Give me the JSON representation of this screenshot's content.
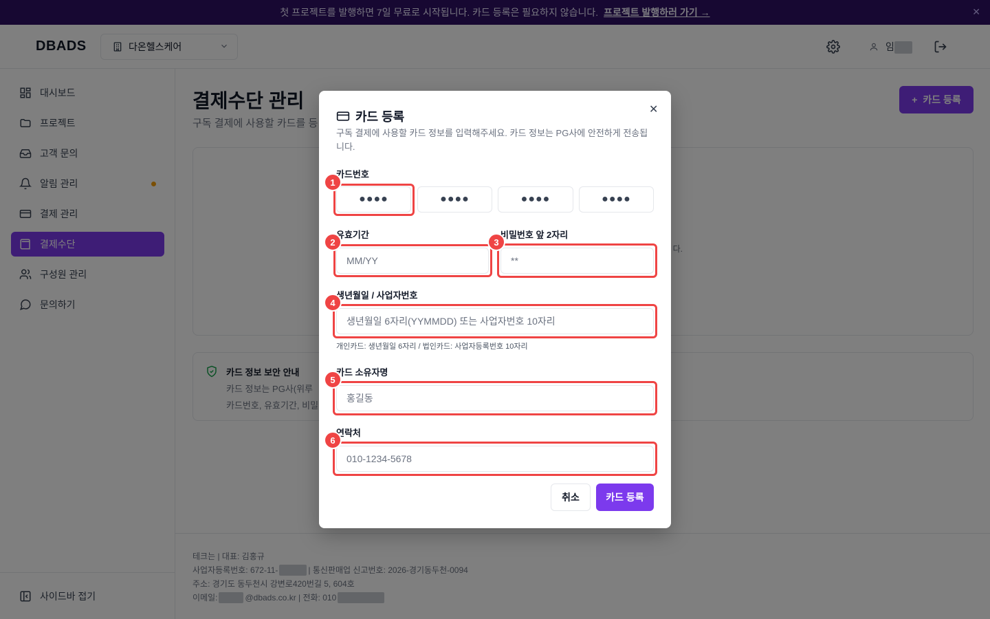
{
  "banner": {
    "text": "첫 프로젝트를 발행하면 7일 무료로 시작됩니다. 카드 등록은 필요하지 않습니다.",
    "link": "프로젝트 발행하러 가기 →",
    "close": "✕"
  },
  "header": {
    "logo": "DBADS",
    "org_name": "다온헬스케어",
    "user_initial": "임"
  },
  "sidebar": {
    "items": [
      {
        "label": "대시보드",
        "icon": "dashboard-icon"
      },
      {
        "label": "프로젝트",
        "icon": "folder-icon"
      },
      {
        "label": "고객 문의",
        "icon": "inbox-icon"
      },
      {
        "label": "알림 관리",
        "icon": "bell-icon"
      },
      {
        "label": "결제 관리",
        "icon": "card-icon"
      },
      {
        "label": "결제수단",
        "icon": "wallet-icon"
      },
      {
        "label": "구성원 관리",
        "icon": "users-icon"
      },
      {
        "label": "문의하기",
        "icon": "chat-icon"
      }
    ],
    "active_index": 5,
    "collapse_label": "사이드바 접기"
  },
  "main": {
    "title": "결제수단 관리",
    "subtitle": "구독 결제에 사용할 카드를 등",
    "add_card": "카드 등록",
    "panel_hint": "다.",
    "security": {
      "title": "카드 정보 보안 안내",
      "line1": "카드 정보는 PG사(위루",
      "line2": "카드번호, 유효기간, 비밀"
    }
  },
  "footer": {
    "line1": "테크는 | 대표: 김홍규",
    "line2_a": "사업자등록번호: 672-11-",
    "line2_b": "| 통신판매업 신고번호: 2026-경기동두천-0094",
    "line3": "주소: 경기도 동두천시 강변로420번길 5, 604호",
    "line4_a": "이메일:",
    "line4_b": "@dbads.co.kr | 전화: 010"
  },
  "modal": {
    "title": "카드 등록",
    "description": "구독 결제에 사용할 카드 정보를 입력해주세요. 카드 정보는 PG사에 안전하게 전송됩니다.",
    "close": "✕",
    "card_number": {
      "label": "카드번호",
      "placeholders": [
        "●●●●",
        "●●●●",
        "●●●●",
        "●●●●"
      ]
    },
    "expiry": {
      "label": "유효기간",
      "placeholder": "MM/YY"
    },
    "password": {
      "label": "비밀번호 앞 2자리",
      "placeholder": "**"
    },
    "birth": {
      "label": "생년월일 / 사업자번호",
      "placeholder": "생년월일 6자리(YYMMDD) 또는 사업자번호 10자리",
      "helper": "개인카드: 생년월일 6자리 / 법인카드: 사업자등록번호 10자리"
    },
    "holder": {
      "label": "카드 소유자명",
      "placeholder": "홍길동"
    },
    "phone": {
      "label": "연락처",
      "placeholder": "010-1234-5678"
    },
    "cancel": "취소",
    "submit": "카드 등록",
    "badges": [
      "1",
      "2",
      "3",
      "4",
      "5",
      "6"
    ]
  },
  "colors": {
    "accent": "#7c3aed",
    "banner_bg": "#2e1065",
    "highlight": "#ef4444",
    "security_green": "#16a34a"
  }
}
